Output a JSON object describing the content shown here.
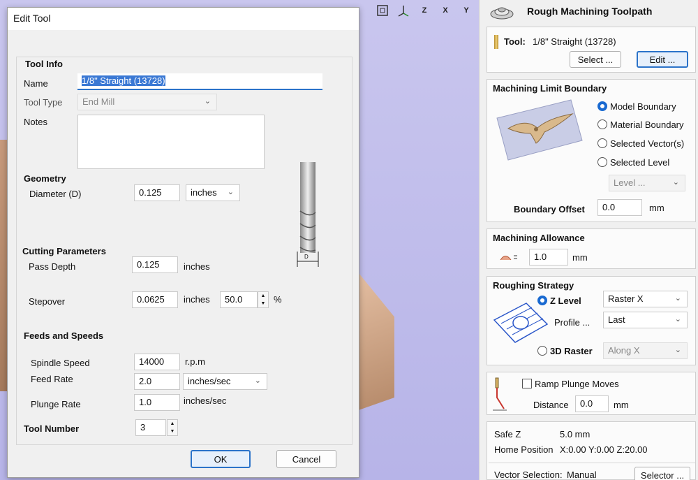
{
  "view_toolbar": {
    "icons": [
      "zoom-extents-icon",
      "iso-view-icon",
      "z-view-icon",
      "x-view-icon",
      "y-view-icon"
    ],
    "labels": [
      "",
      "",
      "Z",
      "X",
      "Y"
    ]
  },
  "dialog": {
    "title": "Edit Tool",
    "tool_info": {
      "section": "Tool Info",
      "name_label": "Name",
      "name_value": "1/8\" Straight (13728)",
      "type_label": "Tool Type",
      "type_value": "End Mill",
      "notes_label": "Notes",
      "notes_value": ""
    },
    "geometry": {
      "section": "Geometry",
      "diameter_label": "Diameter (D)",
      "diameter_value": "0.125",
      "diameter_unit": "inches",
      "diagram_label": "D"
    },
    "cutting": {
      "section": "Cutting Parameters",
      "pass_depth_label": "Pass Depth",
      "pass_depth_value": "0.125",
      "pass_depth_unit": "inches",
      "stepover_label": "Stepover",
      "stepover_value": "0.0625",
      "stepover_unit": "inches",
      "stepover_percent": "50.0",
      "percent_sign": "%"
    },
    "feeds": {
      "section": "Feeds and Speeds",
      "spindle_label": "Spindle Speed",
      "spindle_value": "14000",
      "spindle_unit": "r.p.m",
      "feed_label": "Feed Rate",
      "feed_value": "2.0",
      "feed_unit": "inches/sec",
      "plunge_label": "Plunge Rate",
      "plunge_value": "1.0",
      "plunge_unit": "inches/sec"
    },
    "tool_number": {
      "label": "Tool Number",
      "value": "3"
    },
    "ok_label": "OK",
    "cancel_label": "Cancel"
  },
  "panel": {
    "title": "Rough Machining Toolpath",
    "tool": {
      "label": "Tool:",
      "value": "1/8\" Straight (13728)",
      "select_label": "Select ...",
      "edit_label": "Edit ..."
    },
    "boundary": {
      "title": "Machining Limit Boundary",
      "options": [
        "Model Boundary",
        "Material Boundary",
        "Selected Vector(s)",
        "Selected Level"
      ],
      "selected_index": 0,
      "level_placeholder": "Level ...",
      "offset_label": "Boundary Offset",
      "offset_value": "0.0",
      "offset_unit": "mm"
    },
    "allowance": {
      "title": "Machining Allowance",
      "value": "1.0",
      "unit": "mm"
    },
    "strategy": {
      "title": "Roughing Strategy",
      "zlevel_label": "Z Level",
      "zlevel_value": "Raster X",
      "profile_label": "Profile ...",
      "profile_value": "Last",
      "raster3d_label": "3D Raster",
      "raster3d_value": "Along X"
    },
    "ramp": {
      "checkbox_label": "Ramp Plunge Moves",
      "distance_label": "Distance",
      "distance_value": "0.0",
      "distance_unit": "mm"
    },
    "info": {
      "safe_z_label": "Safe Z",
      "safe_z_value": "5.0 mm",
      "home_label": "Home Position",
      "home_value": "X:0.00 Y:0.00 Z:20.00",
      "vector_sel_label": "Vector Selection:",
      "vector_sel_value": "Manual",
      "selector_label": "Selector ..."
    }
  }
}
